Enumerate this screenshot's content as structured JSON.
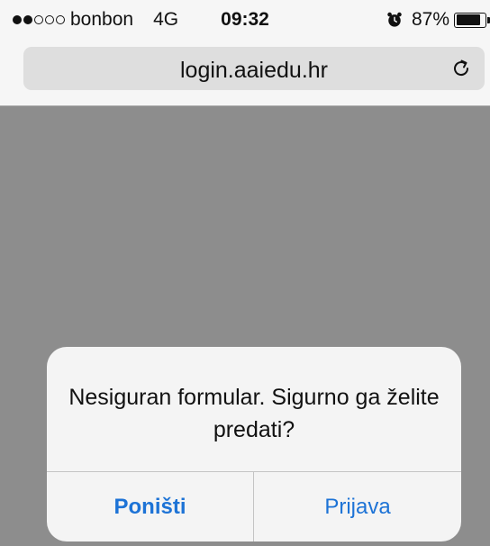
{
  "status_bar": {
    "carrier": "bonbon",
    "network": "4G",
    "time": "09:32",
    "battery_percent": "87%",
    "battery_level": 0.87,
    "signal_bars_filled": 2,
    "signal_bars_total": 5,
    "alarm_icon": "alarm-clock-icon"
  },
  "browser": {
    "url": "login.aaiedu.hr",
    "reload_icon": "reload-icon"
  },
  "alert": {
    "message": "Nesiguran formular. Sigurno ga želite predati?",
    "cancel_label": "Poništi",
    "confirm_label": "Prijava"
  },
  "colors": {
    "accent": "#1d73d6",
    "dimmed_background": "#8d8d8d",
    "bar_background": "#f6f6f6"
  }
}
